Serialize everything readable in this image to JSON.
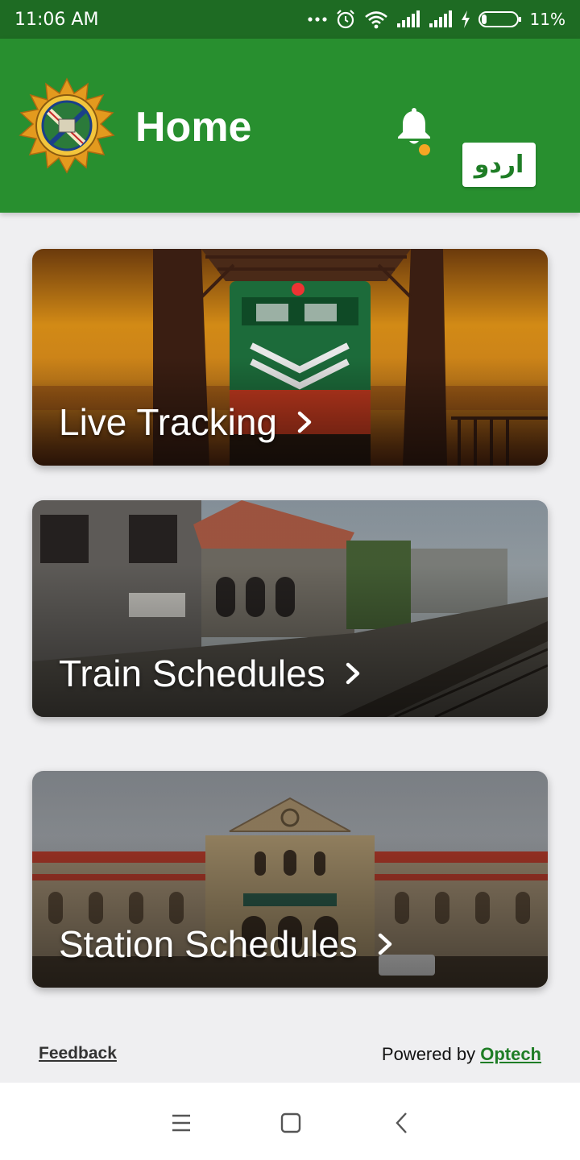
{
  "status_bar": {
    "time": "11:06 AM",
    "battery": "11%",
    "icons": [
      "more-icon",
      "alarm-icon",
      "wifi-icon",
      "signal-icon",
      "signal-icon",
      "charging-icon",
      "battery-icon"
    ]
  },
  "app_bar": {
    "title": "Home",
    "language_button": "اردو",
    "icons": [
      "railway-logo",
      "bell-icon"
    ],
    "colors": {
      "bar": "#288f2f",
      "status": "#1e6b23",
      "badge": "#f5a623"
    }
  },
  "cards": [
    {
      "label": "Live Tracking",
      "icon": "chevron-right-icon"
    },
    {
      "label": "Train Schedules",
      "icon": "chevron-right-icon"
    },
    {
      "label": "Station Schedules",
      "icon": "chevron-right-icon"
    }
  ],
  "footer": {
    "feedback": "Feedback",
    "powered_prefix": "Powered by",
    "powered_link": "Optech"
  },
  "nav_bar": {
    "icons": [
      "menu-icon",
      "home-square-icon",
      "back-icon"
    ]
  }
}
